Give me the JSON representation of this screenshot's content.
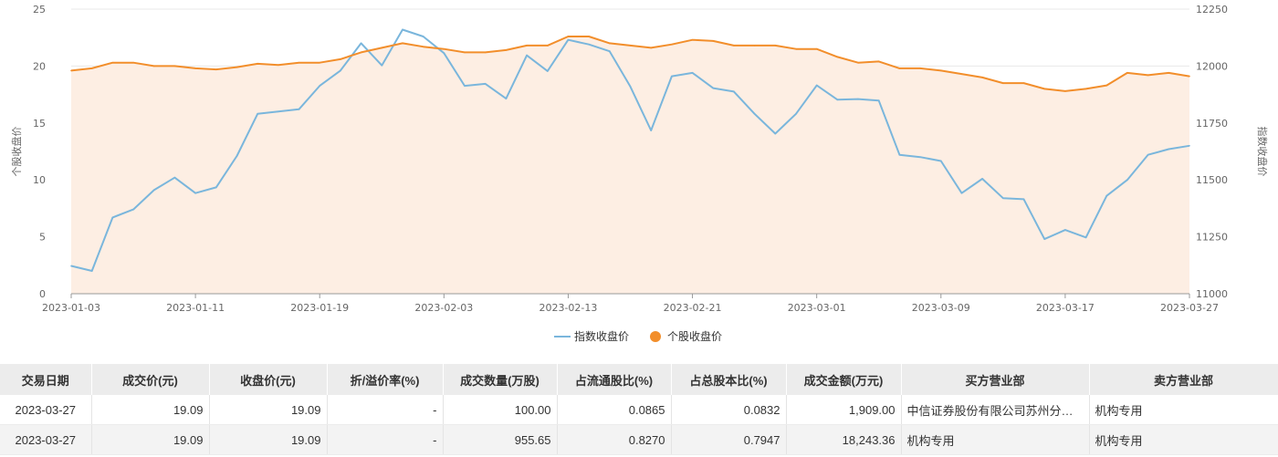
{
  "chart_data": {
    "type": "line",
    "x": [
      "2023-01-03",
      "2023-01-04",
      "2023-01-05",
      "2023-01-06",
      "2023-01-09",
      "2023-01-10",
      "2023-01-11",
      "2023-01-12",
      "2023-01-13",
      "2023-01-16",
      "2023-01-17",
      "2023-01-18",
      "2023-01-19",
      "2023-01-20",
      "2023-01-30",
      "2023-01-31",
      "2023-02-01",
      "2023-02-02",
      "2023-02-03",
      "2023-02-06",
      "2023-02-07",
      "2023-02-08",
      "2023-02-09",
      "2023-02-10",
      "2023-02-13",
      "2023-02-14",
      "2023-02-15",
      "2023-02-16",
      "2023-02-17",
      "2023-02-20",
      "2023-02-21",
      "2023-02-22",
      "2023-02-23",
      "2023-02-24",
      "2023-02-27",
      "2023-02-28",
      "2023-03-01",
      "2023-03-02",
      "2023-03-03",
      "2023-03-06",
      "2023-03-07",
      "2023-03-08",
      "2023-03-09",
      "2023-03-10",
      "2023-03-13",
      "2023-03-14",
      "2023-03-15",
      "2023-03-16",
      "2023-03-17",
      "2023-03-20",
      "2023-03-21",
      "2023-03-22",
      "2023-03-23",
      "2023-03-24",
      "2023-03-27"
    ],
    "x_ticks": [
      "2023-01-03",
      "2023-01-11",
      "2023-01-19",
      "2023-02-03",
      "2023-02-13",
      "2023-02-21",
      "2023-03-01",
      "2023-03-09",
      "2023-03-17",
      "2023-03-27"
    ],
    "y_left": {
      "label": "个股收盘价",
      "range": [
        0,
        25
      ],
      "ticks": [
        "0",
        "5",
        "10",
        "15",
        "20",
        "25"
      ]
    },
    "y_right": {
      "label": "指数收盘价",
      "range": [
        11000,
        12250
      ],
      "ticks": [
        "11000",
        "11250",
        "11500",
        "11750",
        "12000",
        "12250"
      ]
    },
    "grid": true,
    "legend_position": "bottom-center",
    "series": [
      {
        "name": "指数收盘价",
        "axis": "right",
        "color": "#7ab6dc",
        "area": false,
        "values": [
          11122,
          11100,
          11335,
          11370,
          11455,
          11510,
          11442,
          11467,
          11605,
          11790,
          11800,
          11810,
          11913,
          11980,
          12100,
          12003,
          12160,
          12130,
          12057,
          11913,
          11922,
          11857,
          12047,
          11978,
          12115,
          12095,
          12065,
          11910,
          11717,
          11955,
          11970,
          11903,
          11888,
          11790,
          11703,
          11790,
          11915,
          11852,
          11855,
          11848,
          11610,
          11600,
          11583,
          11442,
          11505,
          11420,
          11415,
          11240,
          11280,
          11247,
          11430,
          11500,
          11610,
          11635,
          11650
        ]
      },
      {
        "name": "个股收盘价",
        "axis": "left",
        "color": "#f28e2b",
        "area": true,
        "fill": "#fdeee3",
        "values": [
          19.6,
          19.8,
          20.3,
          20.3,
          20.0,
          20.0,
          19.8,
          19.7,
          19.9,
          20.2,
          20.1,
          20.3,
          20.3,
          20.6,
          21.2,
          21.6,
          22.0,
          21.7,
          21.5,
          21.2,
          21.2,
          21.4,
          21.8,
          21.8,
          22.6,
          22.6,
          22.0,
          21.8,
          21.6,
          21.9,
          22.3,
          22.2,
          21.8,
          21.8,
          21.8,
          21.5,
          21.5,
          20.8,
          20.3,
          20.4,
          19.8,
          19.8,
          19.6,
          19.3,
          19.0,
          18.5,
          18.5,
          18.0,
          17.8,
          18.0,
          18.3,
          19.4,
          19.2,
          19.4,
          19.1
        ]
      }
    ]
  },
  "table": {
    "columns": [
      "交易日期",
      "成交价(元)",
      "收盘价(元)",
      "折/溢价率(%)",
      "成交数量(万股)",
      "占流通股比(%)",
      "占总股本比(%)",
      "成交金额(万元)",
      "买方营业部",
      "卖方营业部"
    ],
    "rows": [
      [
        "2023-03-27",
        "19.09",
        "19.09",
        "-",
        "100.00",
        "0.0865",
        "0.0832",
        "1,909.00",
        "中信证券股份有限公司苏州分…",
        "机构专用"
      ],
      [
        "2023-03-27",
        "19.09",
        "19.09",
        "-",
        "955.65",
        "0.8270",
        "0.7947",
        "18,243.36",
        "机构专用",
        "机构专用"
      ]
    ]
  }
}
